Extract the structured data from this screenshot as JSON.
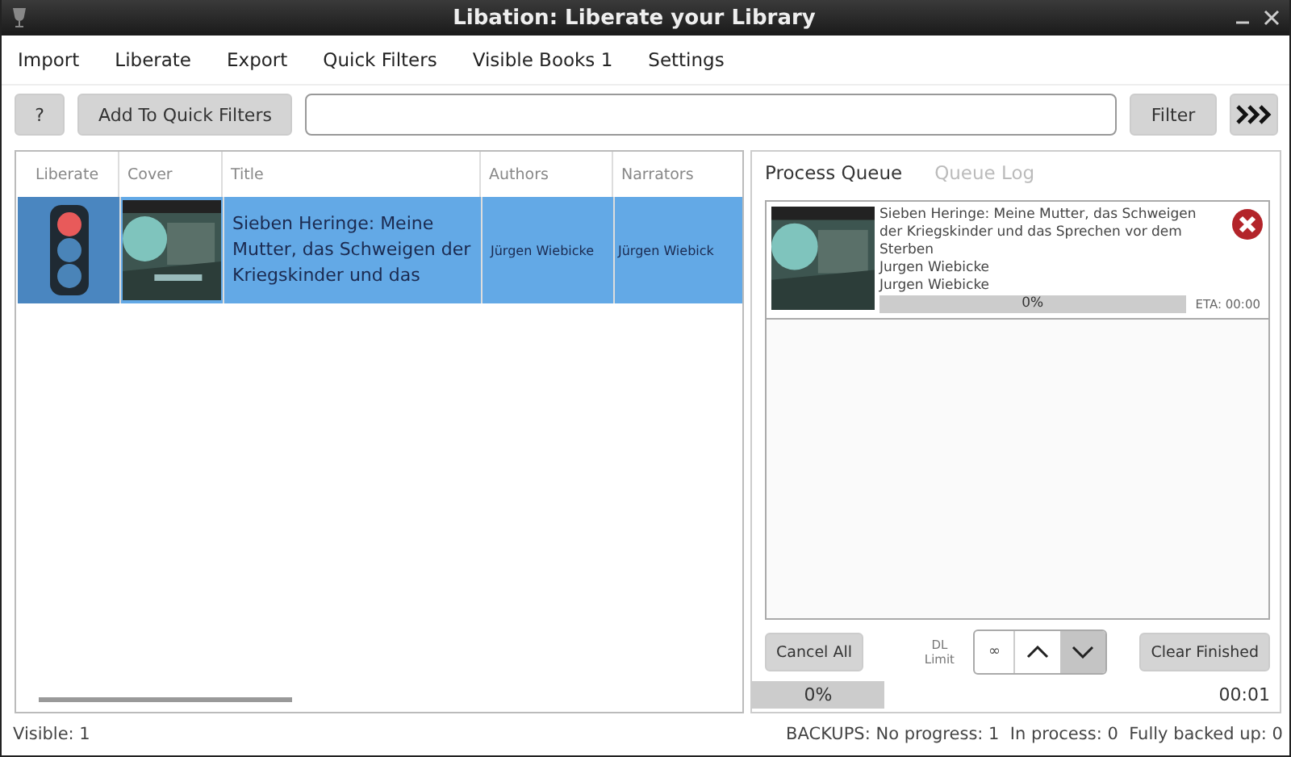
{
  "window": {
    "title": "Libation: Liberate your Library"
  },
  "menu": [
    "Import",
    "Liberate",
    "Export",
    "Quick Filters",
    "Visible Books 1",
    "Settings"
  ],
  "toolbar": {
    "help_button": "?",
    "add_button": "Add To Quick Filters",
    "filter_button": "Filter"
  },
  "grid": {
    "columns": [
      "Liberate",
      "Cover",
      "Title",
      "Authors",
      "Narrators"
    ],
    "rows": [
      {
        "title": "Sieben Heringe: Meine Mutter, das Schweigen der Kriegskinder und das",
        "authors": "Jürgen Wiebicke",
        "narrators": "Jürgen Wiebick",
        "selected": true
      }
    ]
  },
  "queue": {
    "tabs": [
      {
        "label": "Process Queue",
        "selected": true
      },
      {
        "label": "Queue Log",
        "selected": false
      }
    ],
    "items": [
      {
        "title": "Sieben Heringe: Meine Mutter, das Schweigen der Kriegskinder und das Sprechen vor dem Sterben",
        "author": "Jurgen Wiebicke",
        "narrator": "Jurgen Wiebicke",
        "progress": "0%",
        "level": 0,
        "eta": "ETA: 00:00"
      }
    ],
    "cancel_all": "Cancel All",
    "dl_limit_label": "DL Limit",
    "dl_limit_value": "∞",
    "clear_finished": "Clear Finished",
    "overall": {
      "progress": "0%",
      "level": 0
    },
    "elapsed": "00:01"
  },
  "status_bar": {
    "visible": "Visible: 1",
    "backups": "BACKUPS: No progress: 1  In process: 0  Fully backed up: 0"
  }
}
